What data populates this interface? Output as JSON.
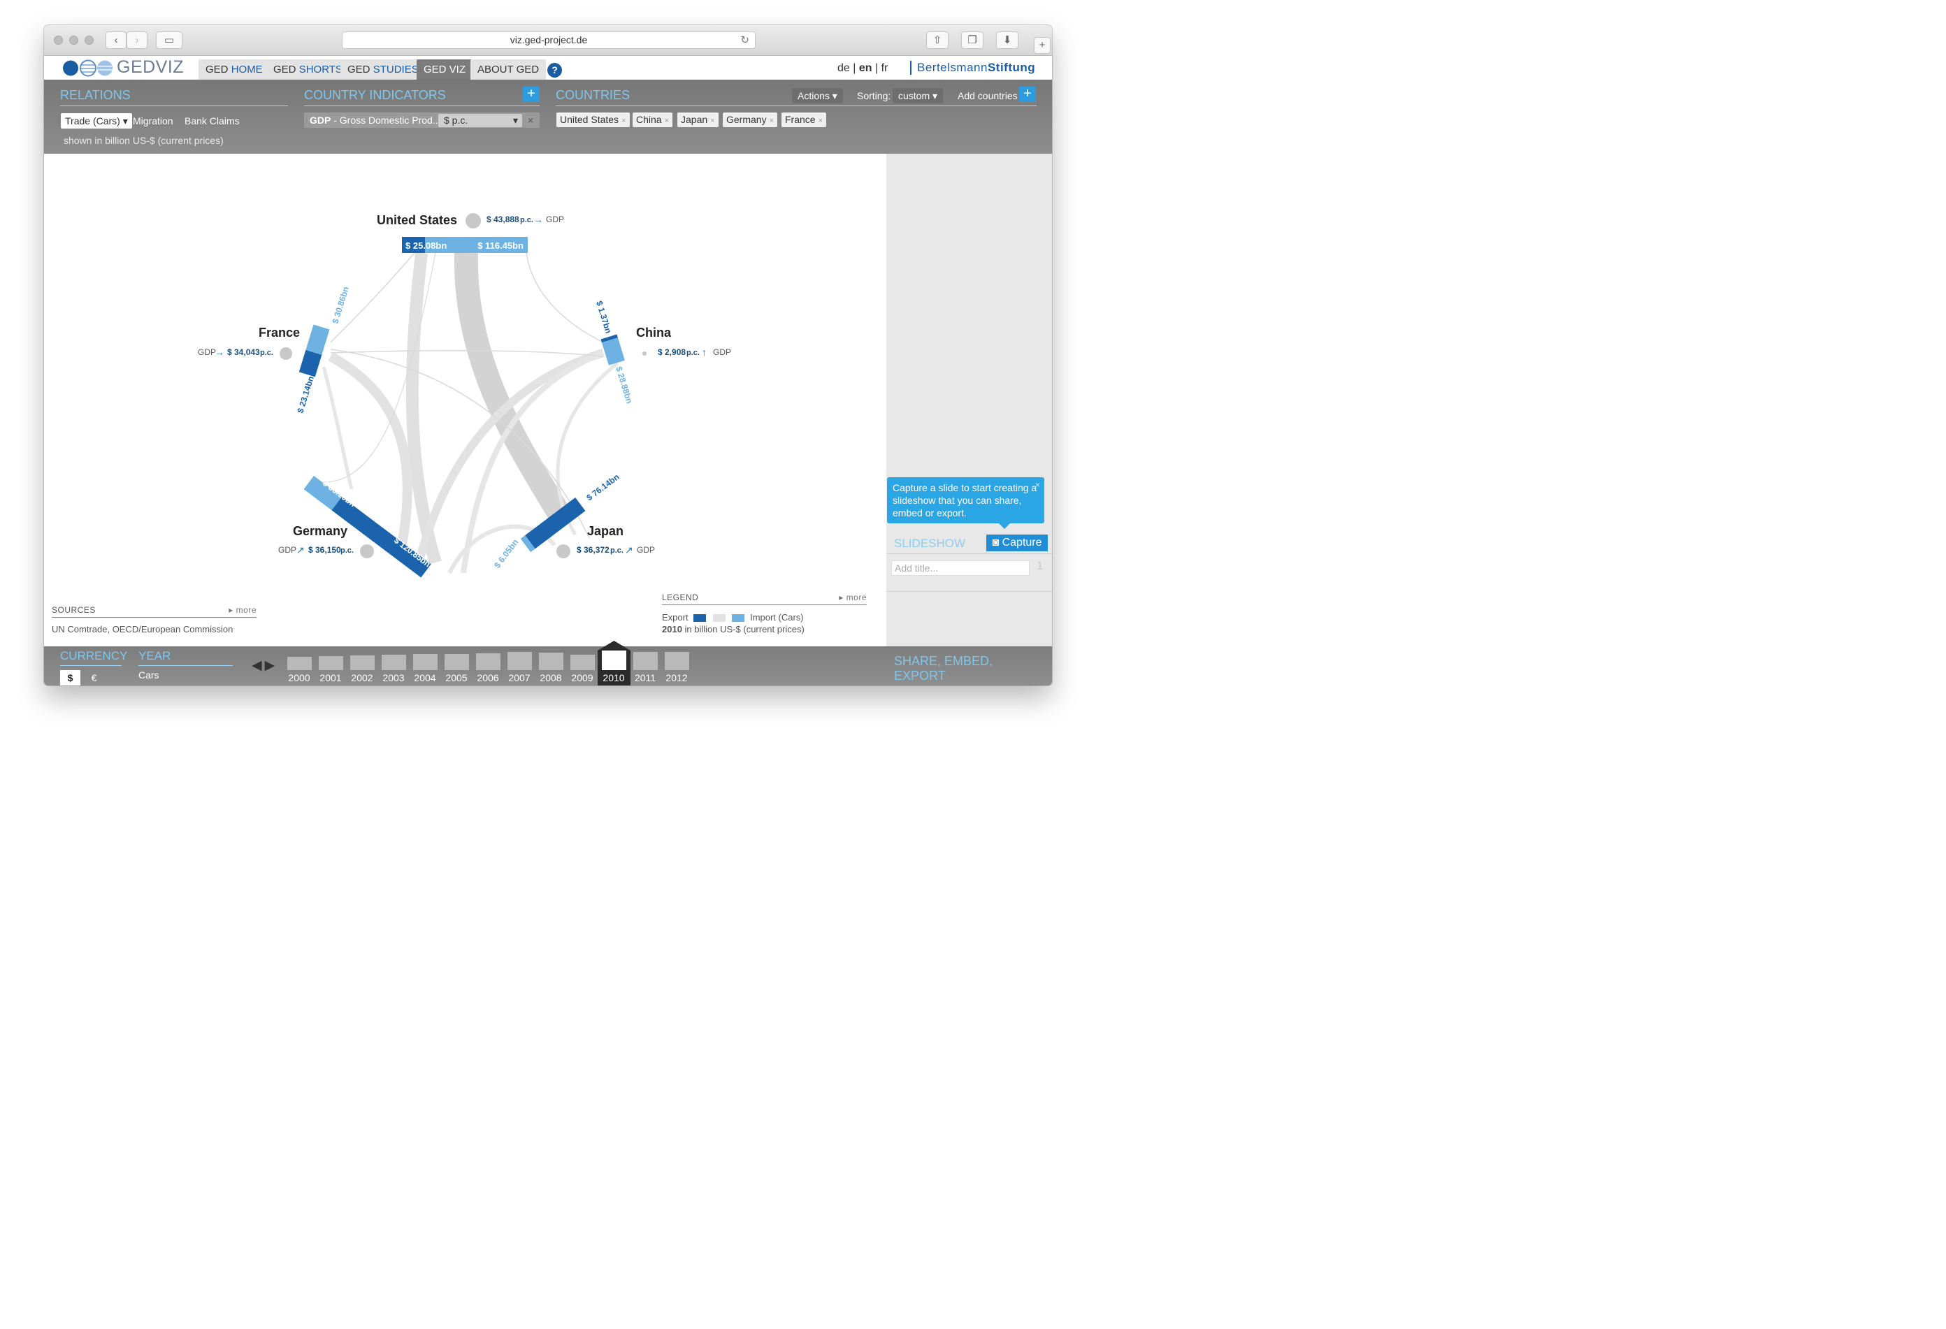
{
  "browser": {
    "url": "viz.ged-project.de"
  },
  "nav": {
    "logo": "GEDVIZ",
    "tabs": [
      {
        "pre": "GED ",
        "em": "HOME"
      },
      {
        "pre": "GED ",
        "em": "SHORTS"
      },
      {
        "pre": "GED ",
        "em": "STUDIES"
      },
      {
        "pre": "GED VIZ",
        "em": ""
      },
      {
        "pre": "ABOUT GED",
        "em": ""
      }
    ],
    "help": "?",
    "langs": [
      "de",
      "en",
      "fr"
    ],
    "brand": "Bertelsmann",
    "brand_bold": "Stiftung"
  },
  "relations": {
    "title": "RELATIONS",
    "options": [
      "Trade (Cars)",
      "Migration",
      "Bank Claims"
    ],
    "note": "shown in billion US-$ (current prices)"
  },
  "indicators": {
    "title": "COUNTRY INDICATORS",
    "plus": "+",
    "selected_code": "GDP",
    "selected_name": " - Gross Domestic Prod...",
    "unit": "$ p.c.",
    "remove": "×"
  },
  "countries": {
    "title": "COUNTRIES",
    "actions": "Actions",
    "sorting_label": "Sorting:",
    "sorting_value": "custom",
    "add": "Add countries",
    "plus": "+",
    "chips": [
      "United States",
      "China",
      "Japan",
      "Germany",
      "France"
    ]
  },
  "viz": {
    "nodes": [
      {
        "name": "United States",
        "gdp": "$ 43,888",
        "pc": "p.c.",
        "arrow": "→",
        "ind": "GDP"
      },
      {
        "name": "China",
        "gdp": "$ 2,908",
        "pc": "p.c.",
        "arrow": "↑",
        "ind": "GDP"
      },
      {
        "name": "Japan",
        "gdp": "$ 36,372",
        "pc": "p.c.",
        "arrow": "↗",
        "ind": "GDP"
      },
      {
        "name": "Germany",
        "gdp": "$ 36,150",
        "pc": "p.c.",
        "arrow": "↗",
        "ind": "GDP"
      },
      {
        "name": "France",
        "gdp": "$ 34,043",
        "pc": "p.c.",
        "arrow": "→",
        "ind": "GDP"
      }
    ],
    "labels": {
      "us_export": "$ 25.08bn",
      "us_import": "$ 116.45bn",
      "cn_export": "$ 1.37bn",
      "cn_import": "$ 28.88bn",
      "jp_export": "$ 76.14bn",
      "jp_import": "$ 6.05bn",
      "de_import": "$ 35.10bn",
      "de_export": "$ 120.85bn",
      "fr_import": "$ 30.86bn",
      "fr_export": "$ 23.14bn"
    }
  },
  "sources": {
    "title": "SOURCES",
    "more": "▸ more",
    "text": "UN Comtrade, OECD/European Commission"
  },
  "legend": {
    "title": "LEGEND",
    "more": "▸ more",
    "export": "Export",
    "import": "Import (Cars)",
    "year": "2010",
    "unit": "in billion US-$ (current prices)"
  },
  "slideshow": {
    "tip": "Capture a slide to start creating a slideshow that you can share, embed or export.",
    "close": "×",
    "title": "SLIDESHOW",
    "capture": "Capture",
    "placeholder": "Add title...",
    "count": "1",
    "share": "SHARE, EMBED, EXPORT"
  },
  "bottom": {
    "currency_title": "CURRENCY",
    "currencies": [
      "$",
      "€"
    ],
    "year_title": "YEAR",
    "year_sub": "Cars",
    "years": [
      "2000",
      "2001",
      "2002",
      "2003",
      "2004",
      "2005",
      "2006",
      "2007",
      "2008",
      "2009",
      "2010",
      "2011",
      "2012"
    ],
    "year_levels": [
      0.45,
      0.5,
      0.55,
      0.6,
      0.7,
      0.7,
      0.75,
      0.85,
      0.8,
      0.6,
      1,
      0.85,
      0.9
    ],
    "selected_year": "2010"
  },
  "colors": {
    "export": "#1b64ad",
    "import": "#6db2e3",
    "accent": "#7ec8f0",
    "flow": "#d9d9d9"
  }
}
